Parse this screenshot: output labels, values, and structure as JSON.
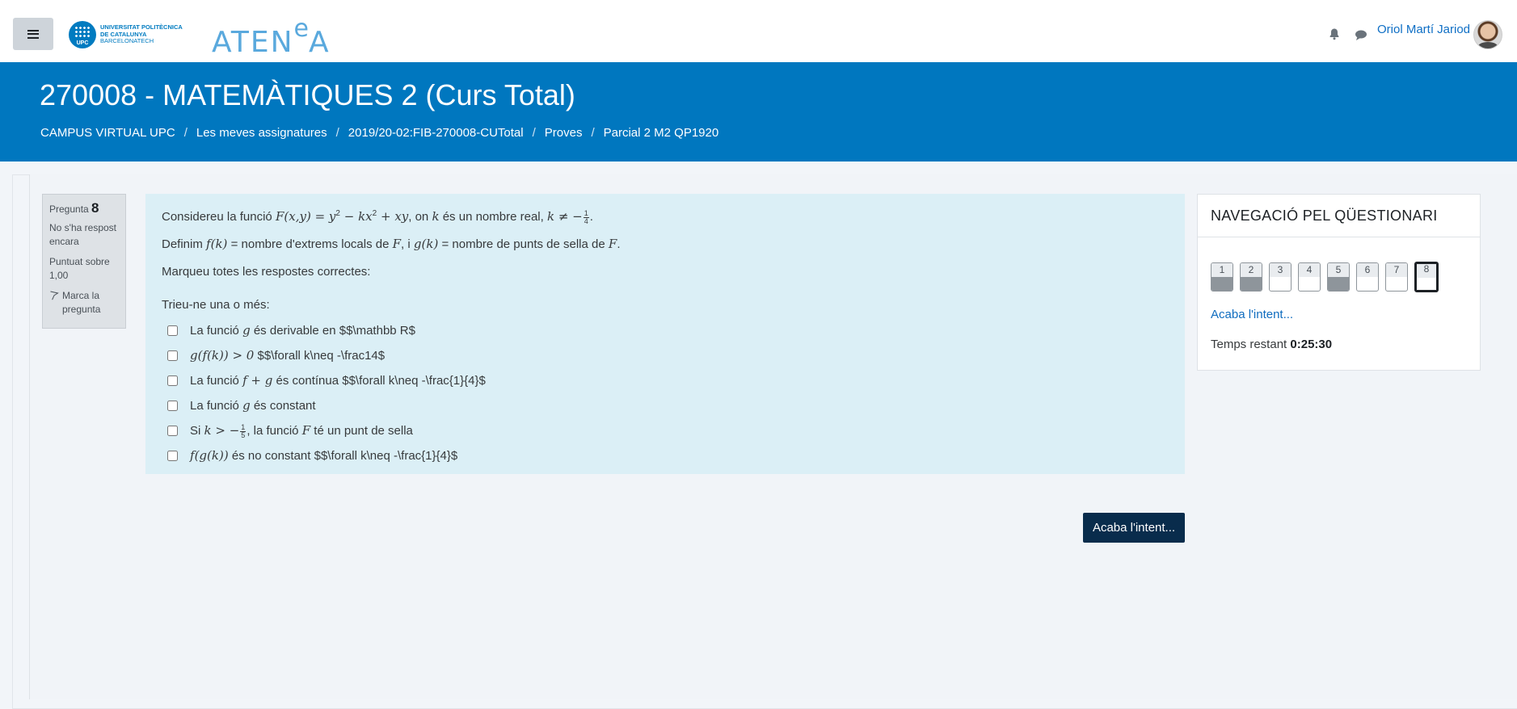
{
  "navbar": {
    "menu_icon": "hamburger-icon",
    "upc_logo": {
      "circle_text": "UPC",
      "line1": "UNIVERSITAT POLITÈCNICA",
      "line2": "DE CATALUNYA",
      "line3": "BARCELONATECH"
    },
    "site_logo_main": "ATEN",
    "site_logo_sup": "e",
    "site_logo_end": "A",
    "notifications_icon": "bell-icon",
    "messages_icon": "chat-icon",
    "user_name": "Oriol Martí Jariod"
  },
  "header": {
    "title": "270008 - MATEMÀTIQUES 2 (Curs Total)",
    "breadcrumb": [
      "CAMPUS VIRTUAL UPC",
      "Les meves assignatures",
      "2019/20-02:FIB-270008-CUTotal",
      "Proves",
      "Parcial 2 M2 QP1920"
    ],
    "separator": "/"
  },
  "question_info": {
    "label": "Pregunta",
    "number": "8",
    "state": "No s'ha respost encara",
    "grade": "Puntuat sobre 1,00",
    "flag_label": "Marca la pregunta"
  },
  "question": {
    "intro_prefix": "Considereu la funció",
    "intro_mid": ", on",
    "intro_mid2": "és un nombre real,",
    "def_prefix": "Definim",
    "def_mid": "= nombre d'extrems locals de",
    "def_mid2": ", i",
    "def_mid3": "= nombre de punts de sella de",
    "instructions": "Marqueu totes les respostes correctes:",
    "prompt": "Trieu-ne una o més:",
    "answers": [
      {
        "pre": "La funció",
        "post": "és derivable en $$\\mathbb R$"
      },
      {
        "pre": "",
        "post": "$$\\forall k\\neq -\\frac14$"
      },
      {
        "pre": "La funció",
        "post": "és contínua $$\\forall k\\neq -\\frac{1}{4}$"
      },
      {
        "pre": "La funció",
        "post": "és constant"
      },
      {
        "pre": "Si",
        "post": ", la funció"
      },
      {
        "pre": "",
        "post": "és no constant $$\\forall k\\neq -\\frac{1}{4}$"
      }
    ],
    "answer5_tail": "té un punt de sella"
  },
  "finish_button": "Acaba l'intent...",
  "quiz_nav": {
    "title": "NAVEGACIÓ PEL QÜESTIONARI",
    "buttons": [
      {
        "label": "1",
        "answered": true
      },
      {
        "label": "2",
        "answered": true
      },
      {
        "label": "3",
        "answered": false
      },
      {
        "label": "4",
        "answered": false
      },
      {
        "label": "5",
        "answered": true
      },
      {
        "label": "6",
        "answered": false
      },
      {
        "label": "7",
        "answered": false
      },
      {
        "label": "8",
        "answered": false,
        "current": true
      }
    ],
    "finish_link": "Acaba l'intent...",
    "timer_label": "Temps restant",
    "timer_value": "0:25:30"
  },
  "colors": {
    "header_blue": "#0077bf",
    "question_bg": "#dbeff6",
    "finish_button_bg": "#092c4c",
    "link_blue": "#0f6cbf"
  }
}
